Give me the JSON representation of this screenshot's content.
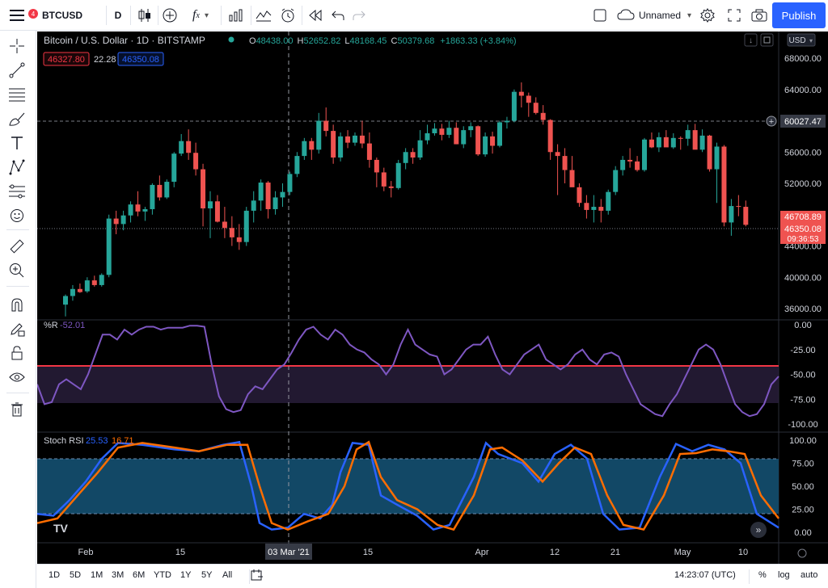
{
  "toolbar": {
    "notification_count": "4",
    "symbol": "BTCUSD",
    "interval": "D",
    "fx_label": "f",
    "layout_name": "Unnamed",
    "publish_label": "Publish"
  },
  "legend": {
    "title": "Bitcoin / U.S. Dollar · 1D · BITSTAMP",
    "o_label": "O",
    "o_value": "48438.00",
    "h_label": "H",
    "h_value": "52652.82",
    "l_label": "L",
    "l_value": "48168.45",
    "c_label": "C",
    "c_value": "50379.68",
    "change": "+1863.33 (+3.84%)",
    "sell_price": "46327.80",
    "spread": "22.28",
    "buy_price": "46350.08"
  },
  "price_axis": {
    "currency": "USD",
    "ticks": [
      "68000.00",
      "64000.00",
      "60000.00",
      "56000.00",
      "52000.00",
      "48000.00",
      "44000.00",
      "40000.00",
      "36000.00"
    ],
    "hline_label": "60027.47",
    "last_price": "46708.89",
    "bid_price": "46350.08",
    "countdown": "09:36:53"
  },
  "williams_r": {
    "label": "%R",
    "value": "-52.01",
    "ticks": [
      "0.00",
      "-25.00",
      "-50.00",
      "-75.00",
      "-100.00"
    ]
  },
  "stoch_rsi": {
    "label": "Stoch RSI",
    "k_value": "25.53",
    "d_value": "16.71",
    "ticks": [
      "100.00",
      "75.00",
      "50.00",
      "25.00",
      "0.00"
    ]
  },
  "time_axis": {
    "labels": [
      "Feb",
      "15",
      "Mar",
      "15",
      "Apr",
      "12",
      "21",
      "May",
      "10"
    ],
    "crosshair_label": "03 Mar '21",
    "tv_logo": "TV"
  },
  "bottombar": {
    "ranges": [
      "1D",
      "5D",
      "1M",
      "3M",
      "6M",
      "YTD",
      "1Y",
      "5Y",
      "All"
    ],
    "time": "14:23:07 (UTC)",
    "percent": "%",
    "log": "log",
    "auto": "auto"
  },
  "colors": {
    "up": "#26a69a",
    "down": "#ef5350",
    "williams": "#7e57c2",
    "k_line": "#2962ff",
    "d_line": "#ff6d00",
    "hline": "#f23645",
    "accent": "#2962ff"
  },
  "chart_data": {
    "type": "candlestick",
    "price_candles": [
      [
        36500,
        37800,
        35000,
        37600
      ],
      [
        37600,
        39000,
        37000,
        38500
      ],
      [
        38500,
        39200,
        38000,
        38100
      ],
      [
        38200,
        40000,
        38000,
        39600
      ],
      [
        39600,
        40200,
        38800,
        39000
      ],
      [
        39000,
        40500,
        38800,
        40300
      ],
      [
        40300,
        48000,
        40000,
        47500
      ],
      [
        47500,
        48500,
        45500,
        46800
      ],
      [
        46800,
        48500,
        46000,
        47900
      ],
      [
        47900,
        49700,
        47000,
        49300
      ],
      [
        49300,
        51000,
        47800,
        48400
      ],
      [
        48400,
        49000,
        47200,
        48700
      ],
      [
        48700,
        52000,
        48000,
        51800
      ],
      [
        51800,
        53000,
        49800,
        50200
      ],
      [
        50200,
        52500,
        50000,
        52200
      ],
      [
        52200,
        56000,
        51500,
        55800
      ],
      [
        55800,
        58300,
        55500,
        57400
      ],
      [
        57400,
        58900,
        55000,
        55900
      ],
      [
        55900,
        57200,
        53000,
        53800
      ],
      [
        53800,
        54500,
        46500,
        48800
      ],
      [
        48800,
        51000,
        45000,
        49700
      ],
      [
        49700,
        50500,
        47000,
        47100
      ],
      [
        47100,
        49000,
        45000,
        46300
      ],
      [
        46300,
        47800,
        44000,
        45100
      ],
      [
        45100,
        46800,
        43500,
        44500
      ],
      [
        44500,
        49000,
        44000,
        48500
      ],
      [
        48500,
        51000,
        47000,
        49800
      ],
      [
        49800,
        52500,
        48500,
        52100
      ],
      [
        52100,
        52300,
        47500,
        48700
      ],
      [
        48700,
        51000,
        48000,
        50200
      ],
      [
        50200,
        52000,
        49000,
        50900
      ],
      [
        50900,
        53500,
        50500,
        53200
      ],
      [
        53200,
        56000,
        52800,
        55500
      ],
      [
        55500,
        57800,
        55000,
        57400
      ],
      [
        57400,
        57800,
        55000,
        56300
      ],
      [
        56300,
        61000,
        55800,
        60000
      ],
      [
        60000,
        61700,
        58000,
        58700
      ],
      [
        58700,
        59500,
        54500,
        55300
      ],
      [
        55300,
        58500,
        54800,
        58000
      ],
      [
        58000,
        58800,
        56500,
        57200
      ],
      [
        57200,
        58500,
        56800,
        58100
      ],
      [
        58100,
        60000,
        56500,
        57100
      ],
      [
        57100,
        58500,
        54000,
        55000
      ],
      [
        55000,
        55300,
        51500,
        53400
      ],
      [
        53400,
        54000,
        51000,
        51600
      ],
      [
        51600,
        52300,
        50200,
        51400
      ],
      [
        51400,
        55000,
        51200,
        54600
      ],
      [
        54600,
        56500,
        53800,
        56000
      ],
      [
        56000,
        56500,
        54500,
        55300
      ],
      [
        55300,
        58800,
        55000,
        57500
      ],
      [
        57500,
        59500,
        57000,
        58400
      ],
      [
        58400,
        59700,
        58100,
        59000
      ],
      [
        59000,
        59600,
        57500,
        58200
      ],
      [
        58200,
        60000,
        57800,
        59100
      ],
      [
        59100,
        59800,
        57000,
        57000
      ],
      [
        57000,
        59300,
        56500,
        58800
      ],
      [
        58800,
        59800,
        57900,
        59300
      ],
      [
        59300,
        59400,
        55500,
        55700
      ],
      [
        55700,
        58500,
        55400,
        58000
      ],
      [
        58000,
        58600,
        55800,
        56800
      ],
      [
        56800,
        60000,
        56600,
        59800
      ],
      [
        59800,
        60500,
        59000,
        60000
      ],
      [
        60000,
        64000,
        59800,
        63700
      ],
      [
        63700,
        64900,
        61700,
        63200
      ],
      [
        63200,
        63600,
        60500,
        62300
      ],
      [
        62300,
        63000,
        60800,
        61000
      ],
      [
        61000,
        62000,
        59500,
        60100
      ],
      [
        60100,
        60200,
        55000,
        56000
      ],
      [
        56000,
        57000,
        50500,
        55500
      ],
      [
        55500,
        56500,
        52000,
        53700
      ],
      [
        53700,
        55500,
        51800,
        51500
      ],
      [
        51500,
        52000,
        49000,
        49500
      ],
      [
        49500,
        50500,
        47500,
        48600
      ],
      [
        48600,
        50500,
        47000,
        49000
      ],
      [
        49000,
        50000,
        47000,
        48500
      ],
      [
        48500,
        51200,
        48000,
        50900
      ],
      [
        50900,
        54200,
        50500,
        53700
      ],
      [
        53700,
        55500,
        53000,
        55000
      ],
      [
        55000,
        56500,
        54000,
        54800
      ],
      [
        54800,
        55500,
        53500,
        53700
      ],
      [
        53700,
        57800,
        53500,
        57600
      ],
      [
        57600,
        58500,
        56500,
        56600
      ],
      [
        56600,
        58500,
        56000,
        57900
      ],
      [
        57900,
        58800,
        56700,
        56600
      ],
      [
        56600,
        58400,
        56400,
        57800
      ],
      [
        57800,
        58000,
        56300,
        57700
      ],
      [
        57700,
        59500,
        56800,
        58800
      ],
      [
        58800,
        59600,
        57700,
        56300
      ],
      [
        56300,
        58900,
        56000,
        58100
      ],
      [
        58100,
        58200,
        53500,
        53800
      ],
      [
        53800,
        57200,
        49500,
        56700
      ],
      [
        56700,
        56900,
        46500,
        47000
      ],
      [
        47000,
        50000,
        45300,
        49100
      ],
      [
        49100,
        50500,
        47800,
        49000
      ],
      [
        49000,
        49800,
        46500,
        46700
      ]
    ],
    "williams_r": [
      -60,
      -80,
      -78,
      -60,
      -55,
      -60,
      -65,
      -50,
      -30,
      -10,
      -10,
      -15,
      -5,
      -10,
      -5,
      -2,
      -2,
      -5,
      -3,
      -3,
      -3,
      -1,
      -1,
      -2,
      -40,
      -72,
      -85,
      -88,
      -86,
      -70,
      -62,
      -65,
      -55,
      -45,
      -40,
      -28,
      -15,
      -5,
      -2,
      -10,
      -15,
      -5,
      -10,
      -20,
      -25,
      -28,
      -35,
      -40,
      -50,
      -40,
      -20,
      -5,
      -20,
      -25,
      -30,
      -32,
      -50,
      -45,
      -35,
      -25,
      -20,
      -20,
      -12,
      -30,
      -45,
      -50,
      -40,
      -30,
      -25,
      -20,
      -35,
      -40,
      -45,
      -40,
      -30,
      -25,
      -35,
      -40,
      -30,
      -28,
      -32,
      -50,
      -65,
      -80,
      -85,
      -90,
      -92,
      -80,
      -70,
      -55,
      -40,
      -25,
      -20,
      -25,
      -40,
      -60,
      -80,
      -88,
      -92,
      -90,
      -80,
      -60,
      -52
    ]
  }
}
